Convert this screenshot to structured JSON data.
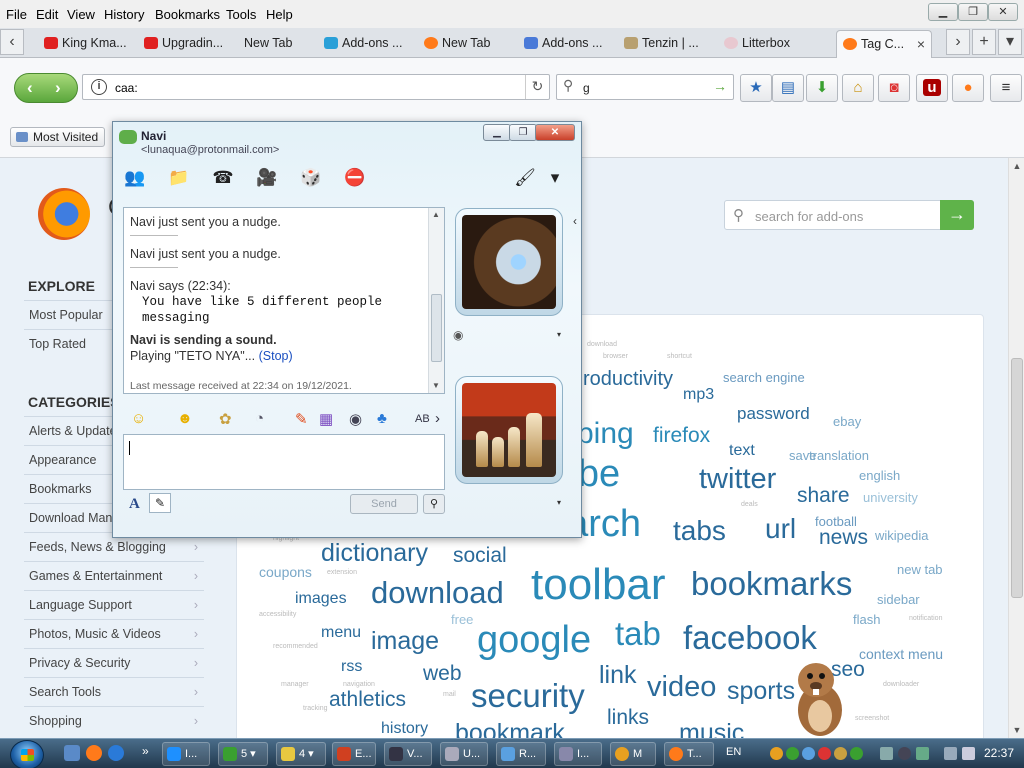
{
  "menubar": {
    "items": [
      "File",
      "Edit",
      "View",
      "History",
      "Bookmarks",
      "Tools",
      "Help"
    ],
    "min": "▁",
    "max": "❐",
    "close": "✕"
  },
  "tabs": {
    "items": [
      {
        "label": "King Kma...",
        "color": "#e02020"
      },
      {
        "label": "Upgradin...",
        "color": "#e02020"
      },
      {
        "label": "New Tab",
        "color": "#dfe3e8"
      },
      {
        "label": "Add-ons ...",
        "color": "#2aa0d8"
      },
      {
        "label": "New Tab",
        "color": "#ff7a1a"
      },
      {
        "label": "Add-ons ...",
        "color": "#4a7ad8"
      },
      {
        "label": "Tenzin | ...",
        "color": "#b8a070"
      },
      {
        "label": "Litterbox",
        "color": "#e8c8d0"
      },
      {
        "label": "Tag C...",
        "color": "#ff7a1a"
      }
    ],
    "close": "×",
    "scroll_left": "‹",
    "scroll_right": "›",
    "new_tab": "+"
  },
  "navbar": {
    "back": "‹",
    "forward": "›",
    "url": "caa:",
    "search_value": "g",
    "reload": "↻",
    "search_go": "→",
    "buttons": [
      {
        "icon": "star-icon",
        "glyph": "★",
        "color": "#2a6ab8"
      },
      {
        "icon": "clipboard-icon",
        "glyph": "▤",
        "color": "#2a6ab8"
      },
      {
        "icon": "download-icon",
        "glyph": "⬇",
        "color": "#3aa030"
      },
      {
        "icon": "home-icon",
        "glyph": "⌂",
        "color": "#c8900a"
      },
      {
        "icon": "pocket-icon",
        "glyph": "◙",
        "color": "#d33"
      },
      {
        "icon": "ublock-icon",
        "glyph": "u",
        "color": "#a00"
      },
      {
        "icon": "firefox-icon",
        "glyph": "●",
        "color": "#ff7a1a"
      },
      {
        "icon": "menu-icon",
        "glyph": "≡",
        "color": "#333"
      }
    ]
  },
  "bookmarks": {
    "most_visited": "Most Visited"
  },
  "page": {
    "logo_text": "C",
    "explore_heading": "EXPLORE",
    "explore_items": [
      "Most Popular",
      "Top Rated"
    ],
    "categories_heading": "CATEGORIES",
    "category_items": [
      "Alerts & Updates",
      "Appearance",
      "Bookmarks",
      "Download Management",
      "Feeds, News & Blogging",
      "Games & Entertainment",
      "Language Support",
      "Photos, Music & Videos",
      "Privacy & Security",
      "Search Tools",
      "Shopping"
    ],
    "search_placeholder": "search for add-ons",
    "search_go": "→",
    "chevron": "›"
  },
  "tag_cloud": [
    {
      "t": "download",
      "s": 7,
      "c": "#bbb"
    },
    {
      "t": "browser",
      "s": 7,
      "c": "#bbb"
    },
    {
      "t": "shortcut",
      "s": 7,
      "c": "#bbb"
    },
    {
      "t": "roductivity",
      "s": 20,
      "c": "#2a6a9a"
    },
    {
      "t": "search engine",
      "s": 13,
      "c": "#6a9ac0"
    },
    {
      "t": "mp3",
      "s": 16,
      "c": "#2a6a9a"
    },
    {
      "t": "password",
      "s": 17,
      "c": "#2a6a9a"
    },
    {
      "t": "ebay",
      "s": 13,
      "c": "#7aa8c8"
    },
    {
      "t": "ping",
      "s": 30,
      "c": "#2a8ab8"
    },
    {
      "t": "firefox",
      "s": 21,
      "c": "#2a8ab8"
    },
    {
      "t": "text",
      "s": 16,
      "c": "#2a6a9a"
    },
    {
      "t": "save",
      "s": 13,
      "c": "#7aa8c8"
    },
    {
      "t": "translation",
      "s": 13,
      "c": "#7aa8c8"
    },
    {
      "t": "utube",
      "s": 38,
      "c": "#2a8ab8"
    },
    {
      "t": "twitter",
      "s": 29,
      "c": "#2a6a9a"
    },
    {
      "t": "english",
      "s": 13,
      "c": "#7aa8c8"
    },
    {
      "t": "share",
      "s": 21,
      "c": "#2a6a9a"
    },
    {
      "t": "university",
      "s": 13,
      "c": "#9ac0d8"
    },
    {
      "t": "deals",
      "s": 7,
      "c": "#bbb"
    },
    {
      "t": "football",
      "s": 13,
      "c": "#6a9ac0"
    },
    {
      "t": "search",
      "s": 38,
      "c": "#2a8ab8"
    },
    {
      "t": "tabs",
      "s": 28,
      "c": "#2a6a9a"
    },
    {
      "t": "url",
      "s": 28,
      "c": "#2a6a9a"
    },
    {
      "t": "news",
      "s": 21,
      "c": "#2a6a9a"
    },
    {
      "t": "wikipedia",
      "s": 13,
      "c": "#7aa8c8"
    },
    {
      "t": "highlight",
      "s": 7,
      "c": "#bbb"
    },
    {
      "t": "dictionary",
      "s": 25,
      "c": "#2a6a9a"
    },
    {
      "t": "social",
      "s": 21,
      "c": "#2a6a9a"
    },
    {
      "t": "coupons",
      "s": 14,
      "c": "#7aa8c8"
    },
    {
      "t": "extension",
      "s": 7,
      "c": "#bbb"
    },
    {
      "t": "toolbar",
      "s": 44,
      "c": "#2a8ab8"
    },
    {
      "t": "bookmarks",
      "s": 33,
      "c": "#2a6a9a"
    },
    {
      "t": "new tab",
      "s": 13,
      "c": "#7aa8c8"
    },
    {
      "t": "images",
      "s": 16,
      "c": "#2a6a9a"
    },
    {
      "t": "download",
      "s": 31,
      "c": "#2a6a9a"
    },
    {
      "t": "sidebar",
      "s": 13,
      "c": "#7aa8c8"
    },
    {
      "t": "accessibility",
      "s": 7,
      "c": "#bbb"
    },
    {
      "t": "free",
      "s": 13,
      "c": "#9ac0d8"
    },
    {
      "t": "flash",
      "s": 13,
      "c": "#7aa8c8"
    },
    {
      "t": "notification",
      "s": 7,
      "c": "#bbb"
    },
    {
      "t": "menu",
      "s": 16,
      "c": "#2a6a9a"
    },
    {
      "t": "tab",
      "s": 33,
      "c": "#2a8ab8"
    },
    {
      "t": "image",
      "s": 25,
      "c": "#2a6a9a"
    },
    {
      "t": "google",
      "s": 38,
      "c": "#2a8ab8"
    },
    {
      "t": "facebook",
      "s": 33,
      "c": "#2a6a9a"
    },
    {
      "t": "recommended",
      "s": 7,
      "c": "#bbb"
    },
    {
      "t": "context menu",
      "s": 14,
      "c": "#6a9ac0"
    },
    {
      "t": "rss",
      "s": 16,
      "c": "#2a6a9a"
    },
    {
      "t": "web",
      "s": 21,
      "c": "#2a6a9a"
    },
    {
      "t": "link",
      "s": 25,
      "c": "#2a6a9a"
    },
    {
      "t": "seo",
      "s": 21,
      "c": "#2a6a9a"
    },
    {
      "t": "manager",
      "s": 7,
      "c": "#bbb"
    },
    {
      "t": "navigation",
      "s": 7,
      "c": "#bbb"
    },
    {
      "t": "video",
      "s": 29,
      "c": "#2a6a9a"
    },
    {
      "t": "sports",
      "s": 25,
      "c": "#2a6a9a"
    },
    {
      "t": "downloader",
      "s": 7,
      "c": "#bbb"
    },
    {
      "t": "athletics",
      "s": 21,
      "c": "#2a6a9a"
    },
    {
      "t": "security",
      "s": 33,
      "c": "#2a6a9a"
    },
    {
      "t": "mail",
      "s": 7,
      "c": "#bbb"
    },
    {
      "t": "tracking",
      "s": 7,
      "c": "#bbb"
    },
    {
      "t": "links",
      "s": 21,
      "c": "#2a6a9a"
    },
    {
      "t": "screenshot",
      "s": 7,
      "c": "#bbb"
    },
    {
      "t": "history",
      "s": 16,
      "c": "#2a6a9a"
    },
    {
      "t": "bookmark",
      "s": 25,
      "c": "#2a6a9a"
    },
    {
      "t": "music",
      "s": 25,
      "c": "#2a6a9a"
    }
  ],
  "messenger": {
    "name": "Navi",
    "email": "<lunaqua@protonmail.com>",
    "win_min": "▁",
    "win_max": "❐",
    "win_close": "✕",
    "toolbar": [
      {
        "icon": "invite-icon",
        "glyph": "👥"
      },
      {
        "icon": "share-files-icon",
        "glyph": "📁"
      },
      {
        "icon": "call-icon",
        "glyph": "☎"
      },
      {
        "icon": "video-icon",
        "glyph": "🎥"
      },
      {
        "icon": "games-icon",
        "glyph": "🎲"
      },
      {
        "icon": "block-icon",
        "glyph": "⛔"
      },
      {
        "icon": "paintbrush-icon",
        "glyph": "🖌"
      },
      {
        "icon": "menu-icon",
        "glyph": "▾"
      }
    ],
    "messages": {
      "nudge1": "Navi just sent you a nudge.",
      "nudge2": "Navi just sent you a nudge.",
      "says": "Navi says (22:34):",
      "line1": "You have like 5 different people",
      "line2": "messaging",
      "sound": "Navi is sending a sound.",
      "playing": "Playing \"TETO NYA\"... ",
      "stop": "(Stop)",
      "last": "Last message received at 22:34 on 19/12/2021."
    },
    "format_icons": [
      {
        "icon": "emoticon-icon",
        "glyph": "☺",
        "color": "#e8b000"
      },
      {
        "icon": "wink-icon",
        "glyph": "☻",
        "color": "#e8b000"
      },
      {
        "icon": "sticker-icon",
        "glyph": "✿",
        "color": "#c8a040"
      },
      {
        "icon": "nudge-icon",
        "glyph": "◔",
        "color": "#556"
      },
      {
        "icon": "ink-icon",
        "glyph": "✎",
        "color": "#e04a1a"
      },
      {
        "icon": "background-icon",
        "glyph": "▦",
        "color": "#7a4ac0"
      },
      {
        "icon": "voice-clip-icon",
        "glyph": "◉",
        "color": "#445"
      },
      {
        "icon": "games2-icon",
        "glyph": "♣",
        "color": "#2a7ad8"
      },
      {
        "icon": "font-style-icon",
        "glyph": "AB",
        "color": "#334"
      },
      {
        "icon": "more-icon",
        "glyph": "›",
        "color": "#334"
      }
    ],
    "font_label": "A",
    "send_label": "Send",
    "search_glyph": "⚲",
    "dropdown": "▾",
    "side_chevron": "‹",
    "pencil": "✎"
  },
  "taskbar": {
    "buttons": [
      {
        "label": "I...",
        "color": "#1e90ff"
      },
      {
        "label": "5",
        "color": "#3aa030"
      },
      {
        "label": "4",
        "color": "#e8c840"
      },
      {
        "label": "E...",
        "color": "#d04020"
      },
      {
        "label": "V...",
        "color": "#334"
      },
      {
        "label": "U...",
        "color": "#aab"
      },
      {
        "label": "R...",
        "color": "#5aa0e0"
      },
      {
        "label": "I...",
        "color": "#88a"
      },
      {
        "label": "M",
        "color": "#e8a020"
      },
      {
        "label": "T...",
        "color": "#ff7a1a"
      }
    ],
    "lang": "EN",
    "clock": "22:37"
  }
}
